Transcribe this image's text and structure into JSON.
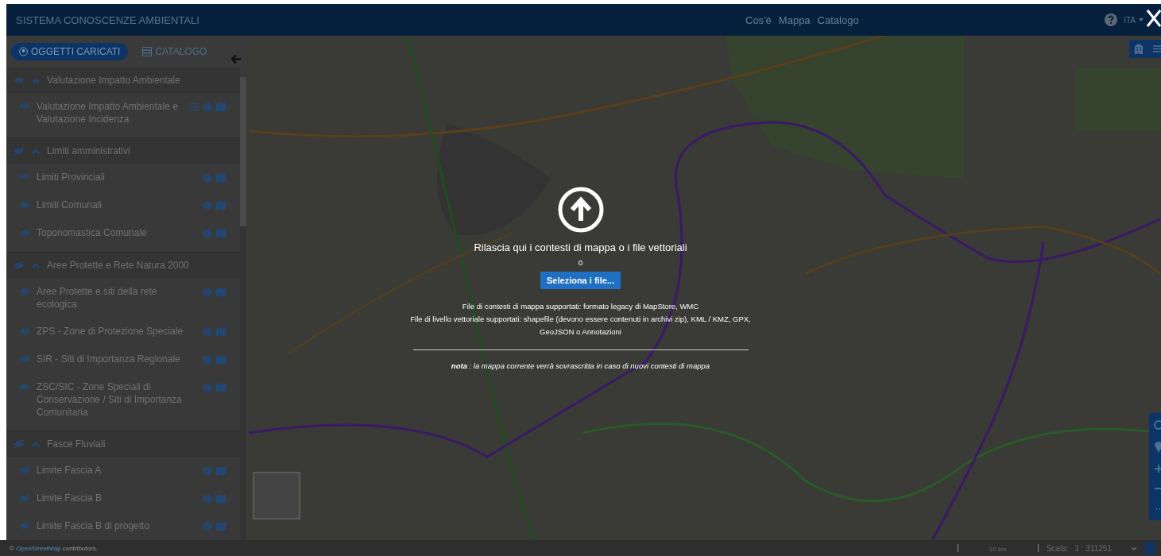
{
  "header": {
    "title": "SISTEMA CONOSCENZE AMBIENTALI",
    "nav": [
      "Cos'è",
      "Mappa",
      "Catalogo"
    ],
    "language": "ITA"
  },
  "sidebar": {
    "tabs": [
      {
        "label": "OGGETTI CARICATI",
        "selected": true
      },
      {
        "label": "CATALOGO",
        "selected": false
      }
    ],
    "groups": [
      {
        "title": "Valutazione Impatto Ambientale",
        "visible": true,
        "expanded": true,
        "layers": [
          {
            "title": "Valutazione Impatto Ambientale e Valutazione Incidenza",
            "visible": true,
            "has_legend": true
          }
        ]
      },
      {
        "title": "Limiti amministrativi",
        "visible": false,
        "expanded": true,
        "layers": [
          {
            "title": "Limiti Provinciali",
            "visible": true,
            "has_legend": false
          },
          {
            "title": "Limiti Comunali",
            "visible": false,
            "has_legend": false
          },
          {
            "title": "Toponomastica Comunale",
            "visible": false,
            "has_legend": false
          }
        ]
      },
      {
        "title": "Aree Protette e Rete Natura 2000",
        "visible": false,
        "expanded": true,
        "layers": [
          {
            "title": "Aree Protette e siti della rete ecologica",
            "visible": false,
            "has_legend": false
          },
          {
            "title": "ZPS - Zone di Protezione Speciale",
            "visible": false,
            "has_legend": false
          },
          {
            "title": "SIR - Siti di Importanza Regionale",
            "visible": false,
            "has_legend": false
          },
          {
            "title": "ZSC/SIC - Zone Speciali di Conservazione / Siti di Importanza Comunitaria",
            "visible": false,
            "has_legend": false
          }
        ]
      },
      {
        "title": "Fasce Fluviali",
        "visible": false,
        "expanded": true,
        "layers": [
          {
            "title": "Limite Fascia A",
            "visible": false,
            "has_legend": false
          },
          {
            "title": "Limite Fascia B",
            "visible": false,
            "has_legend": false
          },
          {
            "title": "Limite Fascia B di progetto",
            "visible": false,
            "has_legend": false
          }
        ]
      }
    ]
  },
  "map": {
    "kind": "picture",
    "attribution": {
      "prefix": "©",
      "link": "OpenStreetMap",
      "suffix": "contributors."
    },
    "scale": {
      "bar": "10 km",
      "label": "Scala:",
      "value": "1 : 311251"
    }
  },
  "dropzone": {
    "title": "Rilascia qui i contesti di mappa o i file vettoriali",
    "separator": "o",
    "button": "Seleziona i file...",
    "info": [
      "File di contesti di mappa supportati: formato legacy di MapStore, WMC",
      "File di livello vettoriale supportati: shapefile (devono essere contenuti in archivi zip), KML / KMZ, GPX, GeoJSON o Annotazioni"
    ],
    "note": "**nota** : la mappa corrente verrà sovrascritta in caso di nuovi contesti di mappa"
  }
}
